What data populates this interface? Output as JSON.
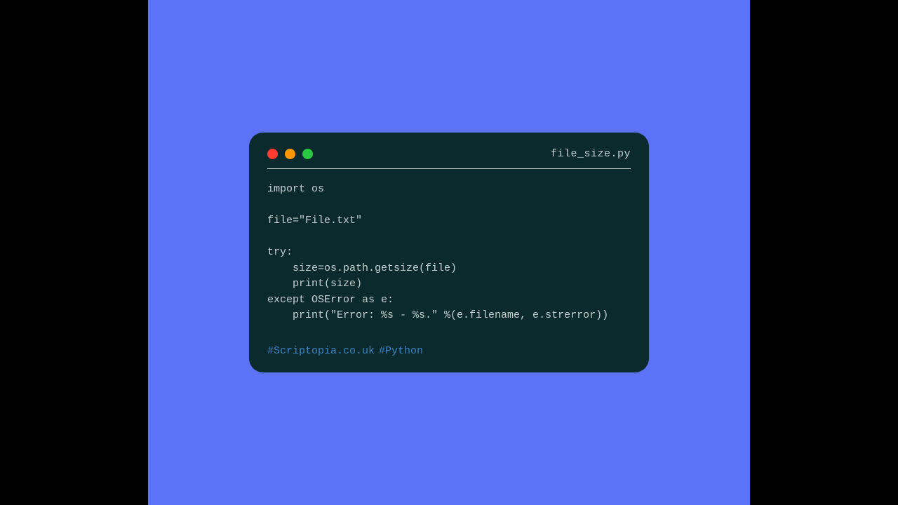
{
  "window": {
    "filename": "file_size.py"
  },
  "code": {
    "lines": [
      "import os",
      "",
      "file=\"File.txt\"",
      "",
      "try:",
      "    size=os.path.getsize(file)",
      "    print(size)",
      "except OSError as e:",
      "    print(\"Error: %s - %s.\" %(e.filename, e.strerror))"
    ]
  },
  "footer": {
    "tag1": "#Scriptopia.co.uk",
    "tag2": "#Python"
  }
}
